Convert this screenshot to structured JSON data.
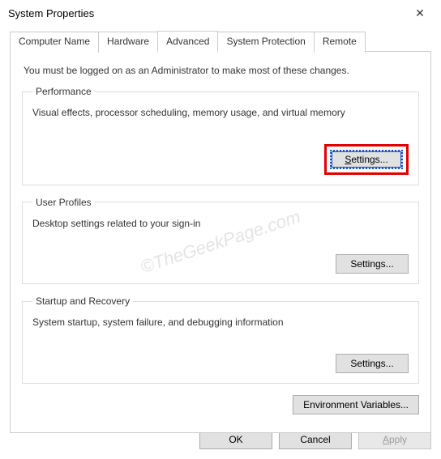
{
  "title": "System Properties",
  "tabs": {
    "computer_name": "Computer Name",
    "hardware": "Hardware",
    "advanced": "Advanced",
    "system_protection": "System Protection",
    "remote": "Remote"
  },
  "intro": "You must be logged on as an Administrator to make most of these changes.",
  "groups": {
    "performance": {
      "legend": "Performance",
      "desc": "Visual effects, processor scheduling, memory usage, and virtual memory",
      "button": "Settings..."
    },
    "user_profiles": {
      "legend": "User Profiles",
      "desc": "Desktop settings related to your sign-in",
      "button": "Settings..."
    },
    "startup": {
      "legend": "Startup and Recovery",
      "desc": "System startup, system failure, and debugging information",
      "button": "Settings..."
    }
  },
  "env_button": "Environment Variables...",
  "buttons": {
    "ok": "OK",
    "cancel": "Cancel",
    "apply": "Apply"
  },
  "watermark": "©TheGeekPage.com"
}
